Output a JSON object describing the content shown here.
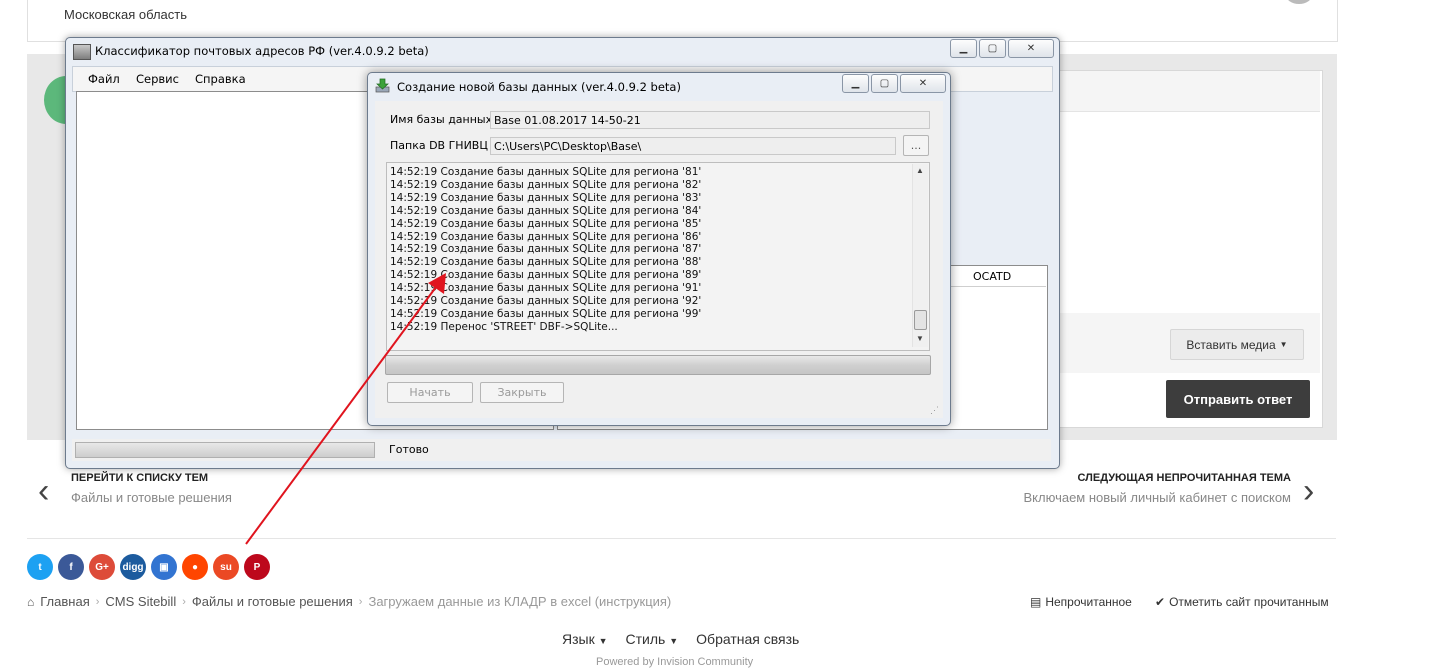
{
  "forum": {
    "region": "Московская область",
    "insert_media": "Вставить медиа",
    "send_reply": "Отправить ответ",
    "prev_title": "ПЕРЕЙТИ К СПИСКУ ТЕМ",
    "prev_sub": "Файлы и готовые решения",
    "next_title": "СЛЕДУЮЩАЯ НЕПРОЧИТАННАЯ ТЕМА",
    "next_sub": "Включаем новый личный кабинет с поиском",
    "share": [
      {
        "name": "twitter",
        "label": "t",
        "color": "#1da1f2"
      },
      {
        "name": "facebook",
        "label": "f",
        "color": "#3b5998"
      },
      {
        "name": "googleplus",
        "label": "G+",
        "color": "#dd4b39"
      },
      {
        "name": "digg",
        "label": "digg",
        "color": "#1c5b9e"
      },
      {
        "name": "delicious",
        "label": "▣",
        "color": "#3274d1"
      },
      {
        "name": "reddit",
        "label": "●",
        "color": "#ff4500"
      },
      {
        "name": "stumbleupon",
        "label": "su",
        "color": "#eb4924"
      },
      {
        "name": "pinterest",
        "label": "P",
        "color": "#bd081c"
      }
    ],
    "breadcrumb": [
      "Главная",
      "CMS Sitebill",
      "Файлы и готовые решения",
      "Загружаем данные из КЛАДР в excel (инструкция)"
    ],
    "unread": "Непрочитанное",
    "mark_read": "Отметить сайт прочитанным",
    "footer": {
      "language": "Язык",
      "style": "Стиль",
      "feedback": "Обратная связь",
      "powered": "Powered by Invision Community"
    }
  },
  "main_window": {
    "title": "Классификатор почтовых адресов РФ     (ver.4.0.9.2 beta)",
    "menu": [
      "Файл",
      "Сервис",
      "Справка"
    ],
    "column_header": "OCATD",
    "status": "Готово"
  },
  "dialog": {
    "title": "Создание новой базы данных    (ver.4.0.9.2 beta)",
    "db_name_label": "Имя базы данных:",
    "db_name_value": "Base 01.08.2017 14-50-21",
    "folder_label": "Папка DB ГНИВЦ",
    "folder_value": "C:\\Users\\PC\\Desktop\\Base\\",
    "browse": "...",
    "log": [
      "14:52:19 Создание базы данных SQLite для региона '81'",
      "14:52:19 Создание базы данных SQLite для региона '82'",
      "14:52:19 Создание базы данных SQLite для региона '83'",
      "14:52:19 Создание базы данных SQLite для региона '84'",
      "14:52:19 Создание базы данных SQLite для региона '85'",
      "14:52:19 Создание базы данных SQLite для региона '86'",
      "14:52:19 Создание базы данных SQLite для региона '87'",
      "14:52:19 Создание базы данных SQLite для региона '88'",
      "14:52:19 Создание базы данных SQLite для региона '89'",
      "14:52:19 Создание базы данных SQLite для региона '91'",
      "14:52:19 Создание базы данных SQLite для региона '92'",
      "14:52:19 Создание базы данных SQLite для региона '99'",
      "14:52:19 Перенос 'STREET' DBF->SQLite..."
    ],
    "start": "Начать",
    "close": "Закрыть"
  },
  "colors": {
    "annotation_arrow": "#e0141e",
    "send_button": "#3d3d3d"
  }
}
